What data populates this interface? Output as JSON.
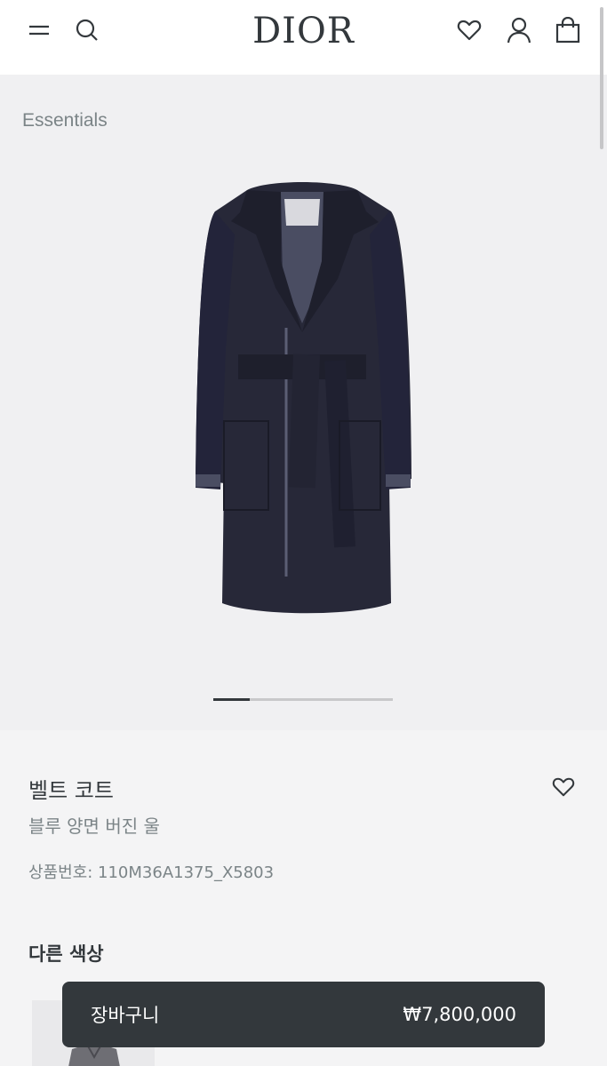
{
  "header": {
    "brand": "DIOR",
    "icons": [
      "menu-icon",
      "search-icon",
      "heart-icon",
      "user-icon",
      "shopping-bag-icon"
    ]
  },
  "gallery": {
    "breadcrumb": "Essentials",
    "image_count_hint": 5,
    "active_index": 1
  },
  "product": {
    "title": "벨트 코트",
    "subtitle": "블루 양면 버진 울",
    "sku_label": "상품번호: 110M36A1375_X5803"
  },
  "other_colors": {
    "heading": "다른 색상"
  },
  "cart": {
    "label": "장바구니",
    "price": "₩7,800,000"
  },
  "colors": {
    "text_primary": "#33383c",
    "text_secondary": "#7b8487",
    "background": "#f4f4f5",
    "coat": "#2a2a3a"
  }
}
